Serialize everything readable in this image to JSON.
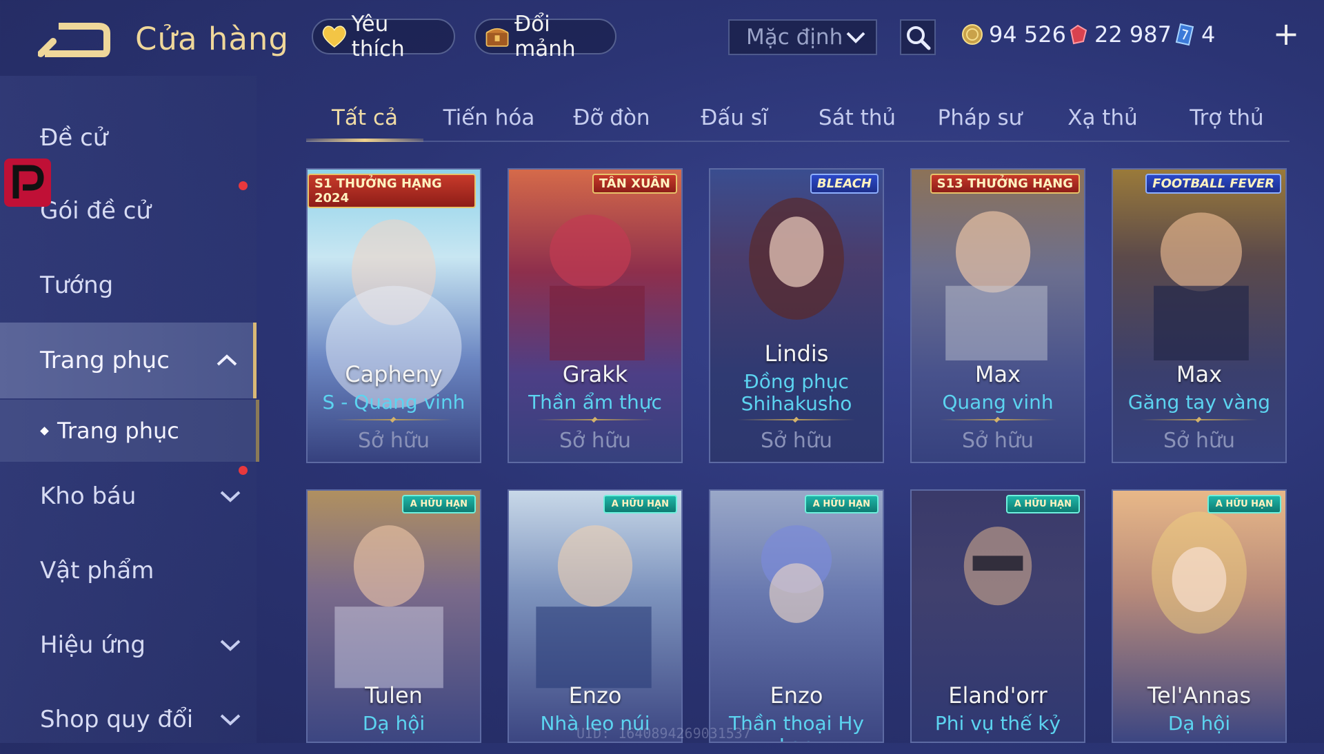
{
  "header": {
    "title": "Cửa hàng",
    "favorites_label": "Yêu thích",
    "fragments_label": "Đổi mảnh",
    "sort_selected": "Mặc định",
    "currencies": {
      "gold": "94 526",
      "ruby": "22 987",
      "voucher": "4"
    },
    "plus_label": "+"
  },
  "sidebar": {
    "items": [
      {
        "label": "Đề cử"
      },
      {
        "label": "Gói đề cử"
      },
      {
        "label": "Tướng"
      },
      {
        "label": "Trang phục"
      },
      {
        "label": "Trang phục"
      },
      {
        "label": "Kho báu"
      },
      {
        "label": "Vật phẩm"
      },
      {
        "label": "Hiệu ứng"
      },
      {
        "label": "Shop quy đổi"
      }
    ]
  },
  "tabs": [
    "Tất cả",
    "Tiến hóa",
    "Đỡ đòn",
    "Đấu sĩ",
    "Sát thủ",
    "Pháp sư",
    "Xạ thủ",
    "Trợ thủ"
  ],
  "active_tab": "Tất cả",
  "cards": [
    {
      "hero": "Capheny",
      "skin": "S - Quang vinh",
      "status": "Sở hữu",
      "badge": "S1 THƯỞNG HẠNG 2024"
    },
    {
      "hero": "Grakk",
      "skin": "Thần ẩm thực",
      "status": "Sở hữu",
      "badge": "TÂN XUÂN"
    },
    {
      "hero": "Lindis",
      "skin": "Đồng phục Shihakusho",
      "status": "Sở hữu",
      "badge": "BLEACH"
    },
    {
      "hero": "Max",
      "skin": "Quang vinh",
      "status": "Sở hữu",
      "badge": "S13 THƯỞNG HẠNG"
    },
    {
      "hero": "Max",
      "skin": "Găng tay vàng",
      "status": "Sở hữu",
      "badge": "FOOTBALL FEVER"
    },
    {
      "hero": "Tulen",
      "skin": "Dạ hội",
      "badge": "A HỮU HẠN"
    },
    {
      "hero": "Enzo",
      "skin": "Nhà leo núi",
      "badge": "A HỮU HẠN"
    },
    {
      "hero": "Enzo",
      "skin": "Thần thoại Hy Lạp",
      "badge": "A HỮU HẠN"
    },
    {
      "hero": "Eland'orr",
      "skin": "Phi vụ thế kỷ",
      "badge": "A HỮU HẠN"
    },
    {
      "hero": "Tel'Annas",
      "skin": "Dạ hội",
      "badge": "A HỮU HẠN"
    }
  ],
  "uid_text": "UID: 1640894269031537",
  "colors": {
    "accent_gold": "#efd79a",
    "skin_cyan": "#5cd4f0",
    "notify_red": "#e8383d",
    "logo_red": "#c01036"
  },
  "icons": [
    "back-arrow-icon",
    "heart-icon",
    "chest-icon",
    "chevron-down-icon",
    "search-icon",
    "gold-coin-icon",
    "ruby-icon",
    "voucher-icon",
    "plus-icon",
    "chevron-up-icon"
  ]
}
